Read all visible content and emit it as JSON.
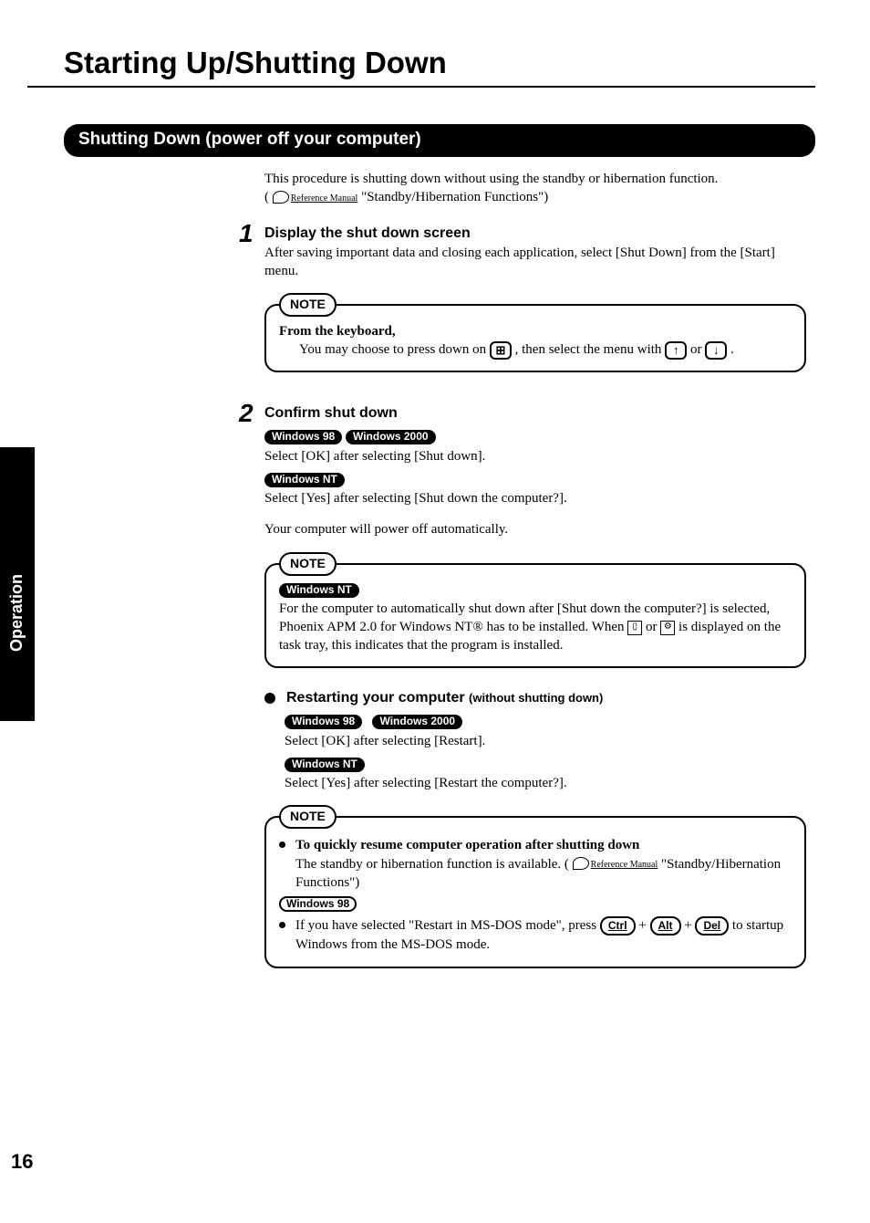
{
  "title": "Starting Up/Shutting Down",
  "sideTab": "Operation",
  "pageNumber": "16",
  "sectionBar": "Shutting Down (power off your computer)",
  "intro1": "This procedure is shutting down without using the standby or hibernation function.",
  "intro2_quote": "(",
  "intro2_ref": "Reference Manual",
  "intro2_text": " \"Standby/Hibernation Functions\")",
  "step1": {
    "num": "1",
    "title": "Display the shut down screen",
    "body": "After saving important data and closing each application, select [Shut Down] from the [Start] menu."
  },
  "note1": {
    "label": "NOTE",
    "line1": "From the keyboard,",
    "line2a": "You may choose to press down on ",
    "line2b": " , then select the menu with ",
    "line2c": " or ",
    "line2d": " .",
    "keyWin": "⊞",
    "keyUp": "↑",
    "keyDown": "↓"
  },
  "step2": {
    "num": "2",
    "title": "Confirm shut down",
    "os1": "Windows 98",
    "os2": "Windows 2000",
    "line1": "Select [OK] after selecting [Shut down].",
    "os3": "Windows NT",
    "line2": "Select [Yes] after selecting [Shut down the computer?].",
    "line3": "Your computer will power off automatically."
  },
  "note2": {
    "label": "NOTE",
    "os": "Windows NT",
    "body1": "For the computer to automatically shut down after [Shut down the computer?] is selected, Phoenix APM 2.0 for Windows NT® has to be installed.  When ",
    "body2": " or ",
    "body3": " is displayed on the task tray, this indicates that the program is installed."
  },
  "restart": {
    "title": "Restarting your computer",
    "sub": " (without shutting down)",
    "os1": "Windows 98",
    "os2": "Windows 2000",
    "line1": "Select [OK] after selecting [Restart].",
    "os3": "Windows NT",
    "line2": "Select [Yes] after selecting [Restart the computer?]."
  },
  "note3": {
    "label": "NOTE",
    "bullet1_bold": "To quickly resume computer operation after shutting down",
    "bullet1_a": "The standby or hibernation function is available. (",
    "bullet1_ref": "Reference Manual",
    "bullet1_b": " \"Standby/Hibernation Functions\")",
    "os": "Windows 98",
    "bullet2_a": "If you have selected \"Restart in MS-DOS mode\", press ",
    "bullet2_plus": "+",
    "bullet2_b": " to startup Windows from the MS-DOS mode.",
    "keyCtrl": "Ctrl",
    "keyAlt": "Alt",
    "keyDel": "Del"
  }
}
